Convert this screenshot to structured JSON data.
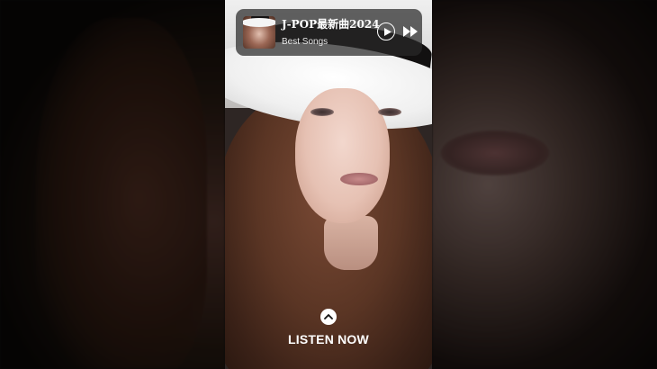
{
  "player": {
    "title": "J-POP最新曲2024",
    "subtitle": "Best Songs",
    "play_icon": "play-circle-icon",
    "next_icon": "fast-forward-icon"
  },
  "cta": {
    "label": "LISTEN NOW",
    "icon": "chevron-up-icon"
  },
  "colors": {
    "card_bg": "#282828",
    "text": "#ffffff"
  }
}
